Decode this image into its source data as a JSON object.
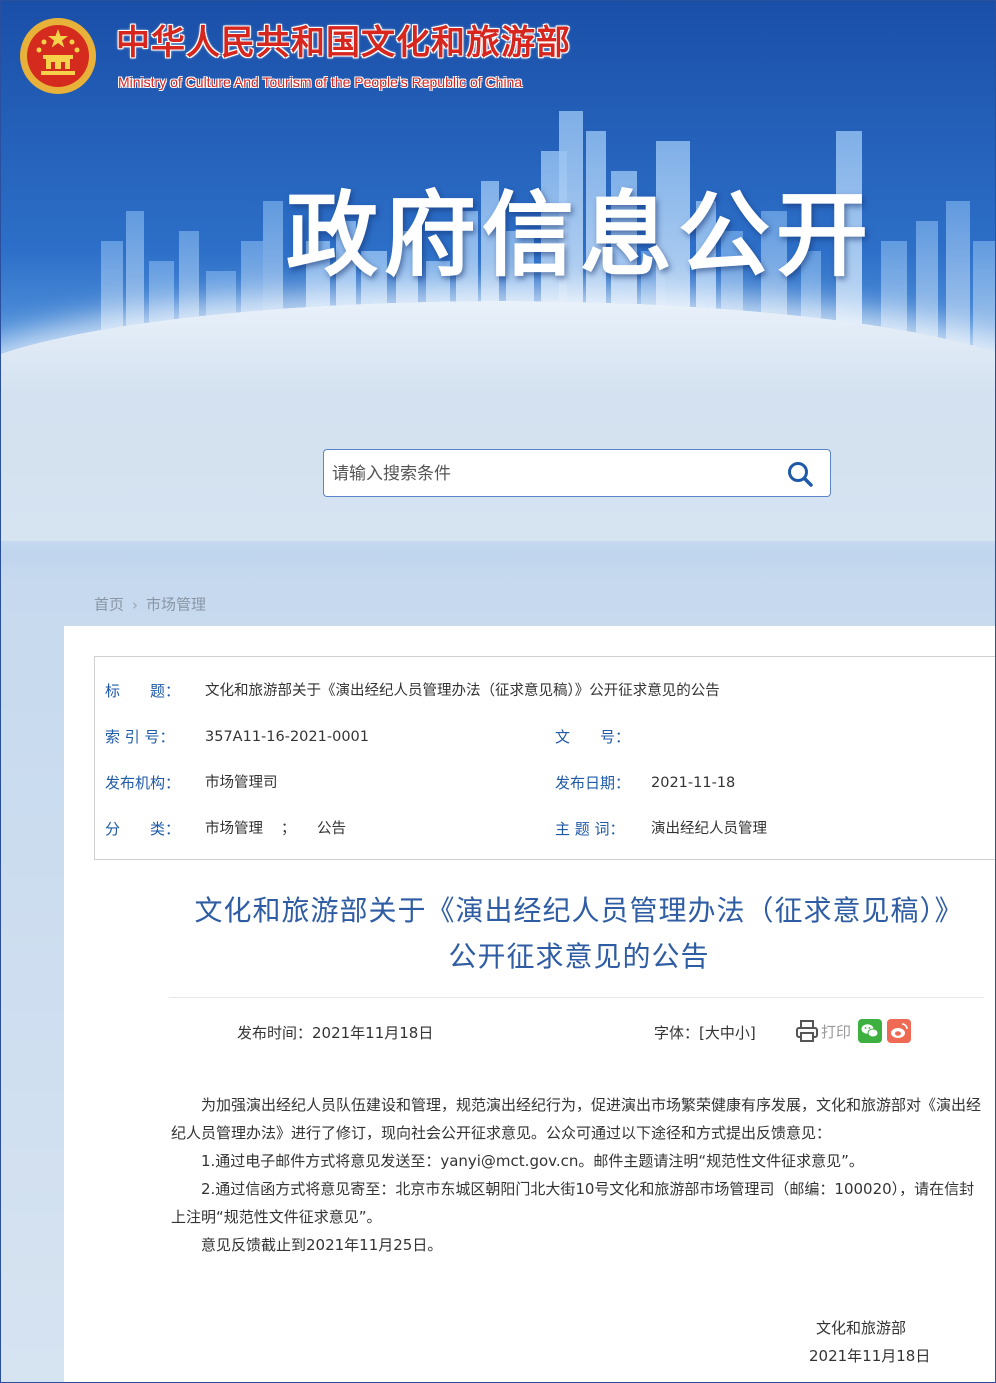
{
  "header": {
    "ministry_name_cn": "中华人民共和国文化和旅游部",
    "ministry_name_en": "Ministry of Culture And Tourism of the People’s Republic of China",
    "banner_title": "政府信息公开"
  },
  "search": {
    "placeholder": "请输入搜索条件"
  },
  "breadcrumb": {
    "home": "首页",
    "current": "市场管理"
  },
  "meta": {
    "title_label": "标　　题：",
    "title_value": "文化和旅游部关于《演出经纪人员管理办法（征求意见稿）》公开征求意见的公告",
    "index_label": "索 引 号：",
    "index_value": "357A11-16-2021-0001",
    "docno_label": "文　　号：",
    "docno_value": "",
    "org_label": "发布机构：",
    "org_value": "市场管理司",
    "date_label": "发布日期：",
    "date_value": "2021-11-18",
    "category_label": "分　　类：",
    "category_value_1": "市场管理",
    "category_sep": "；",
    "category_value_2": "公告",
    "keyword_label": "主 题 词：",
    "keyword_value": "演出经纪人员管理"
  },
  "article": {
    "title_line1": "文化和旅游部关于《演出经纪人员管理办法（征求意见稿）》",
    "title_line2": "公开征求意见的公告",
    "publish_time": "发布时间：2021年11月18日",
    "font_label": "字体：",
    "font_open": "[",
    "font_large": "大",
    "font_medium": "中",
    "font_small": "小",
    "font_close": "]",
    "print_label": "打印",
    "paragraphs": [
      "为加强演出经纪人员队伍建设和管理，规范演出经纪行为，促进演出市场繁荣健康有序发展，文化和旅游部对《演出经纪人员管理办法》进行了修订，现向社会公开征求意见。公众可通过以下途径和方式提出反馈意见：",
      "1.通过电子邮件方式将意见发送至：yanyi@mct.gov.cn。邮件主题请注明“规范性文件征求意见”。",
      "2.通过信函方式将意见寄至：北京市东城区朝阳门北大街10号文化和旅游部市场管理司（邮编：100020），请在信封上注明“规范性文件征求意见”。",
      "意见反馈截止到2021年11月25日。"
    ],
    "signature": "文化和旅游部",
    "signature_date": "2021年11月18日"
  },
  "colors": {
    "ministry_red": "#d7261e",
    "label_blue": "#1f5aa8",
    "title_blue": "#2f5da3"
  }
}
